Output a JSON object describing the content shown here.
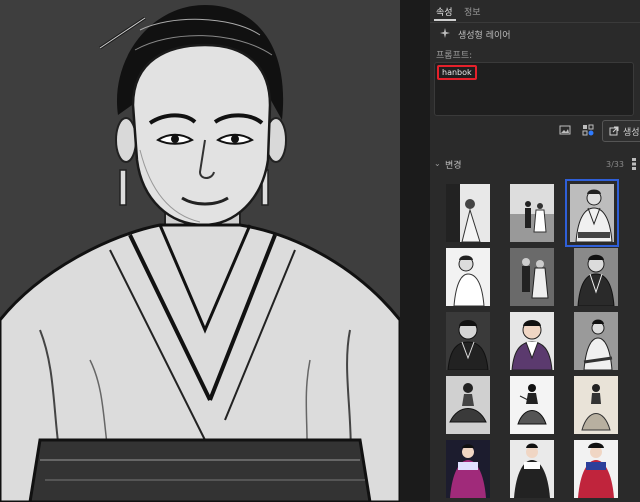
{
  "canvas": {
    "description_icon": "portrait-illustration"
  },
  "panel": {
    "tabs": [
      {
        "label": "속성",
        "active": true
      },
      {
        "label": "정보",
        "active": false
      }
    ],
    "layer": {
      "icon": "sparkle-icon",
      "label": "생성형 레이어"
    },
    "prompt": {
      "label": "프롬프트:",
      "value": "hanbok"
    },
    "tools": {
      "gen_label": "생성"
    },
    "variations": {
      "title": "변경",
      "count": "3/33"
    }
  },
  "colors": {
    "selection": "#2f5fd8",
    "highlight": "#e5212b",
    "panel_bg": "#2a2a2a"
  }
}
